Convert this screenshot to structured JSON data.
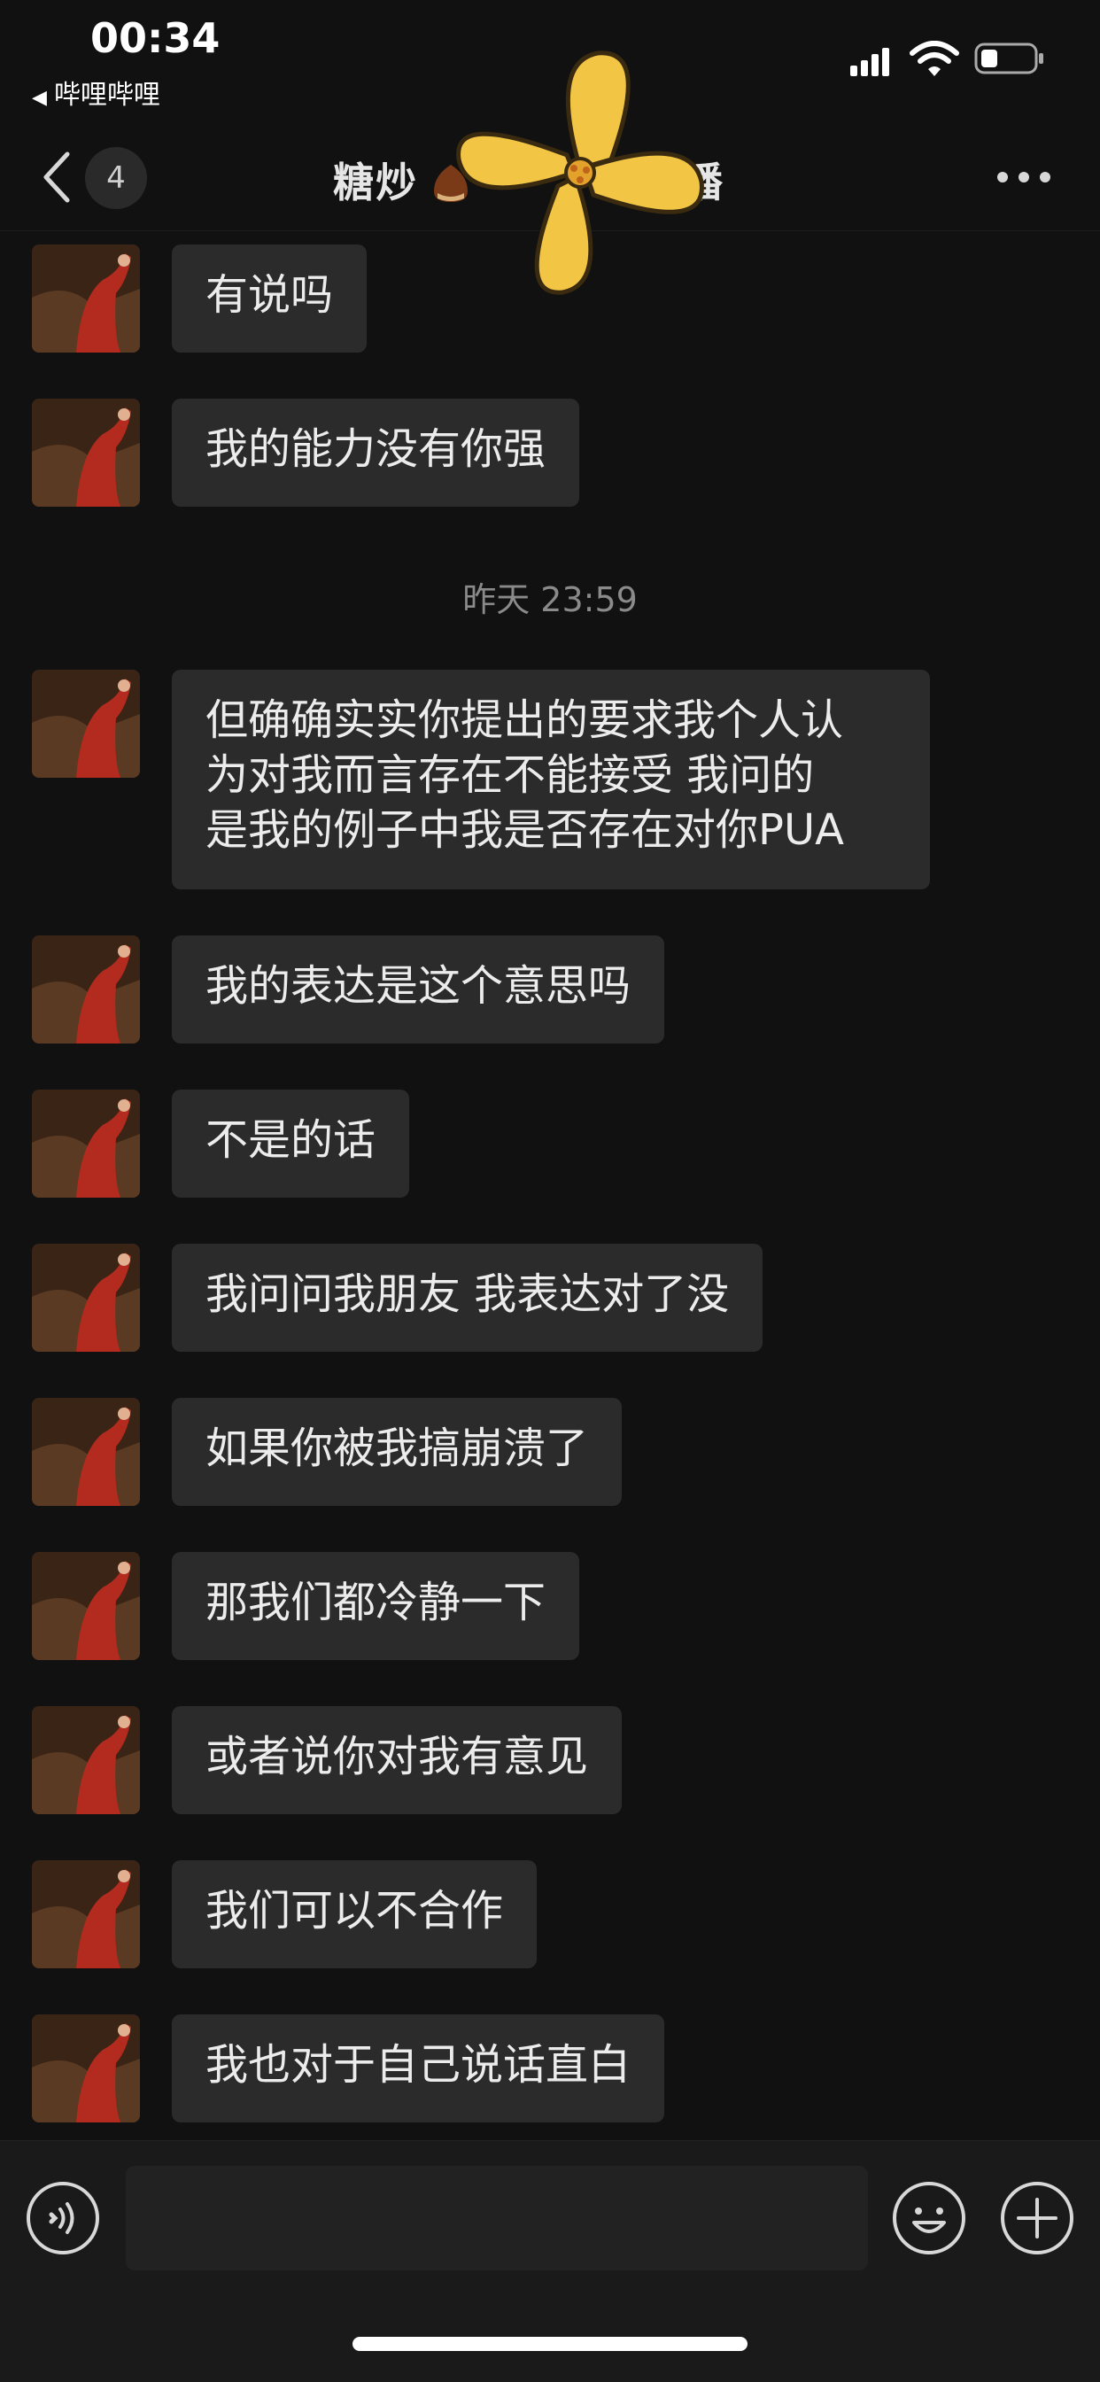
{
  "status": {
    "time": "00:34",
    "back_app": "哔哩哔哩",
    "back_arrow": "◀"
  },
  "nav": {
    "unread_count": "4",
    "title_left": "糖炒",
    "title_right": "主播",
    "back_icon": "chevron-left-icon",
    "more_icon": "more-icon"
  },
  "timestamp": "昨天 23:59",
  "messages": [
    {
      "text": "有说吗"
    },
    {
      "text": "我的能力没有你强"
    },
    {
      "text": "但确确实实你提出的要求我个人认\n为对我而言存在不能接受 我问的\n是我的例子中我是否存在对你PUA"
    },
    {
      "text": "我的表达是这个意思吗"
    },
    {
      "text": "不是的话"
    },
    {
      "text": "我问问我朋友 我表达对了没"
    },
    {
      "text": "如果你被我搞崩溃了"
    },
    {
      "text": "那我们都冷静一下"
    },
    {
      "text": "或者说你对我有意见"
    },
    {
      "text": "我们可以不合作"
    },
    {
      "text": "我也对于自己说话直白"
    }
  ],
  "input": {
    "value": "",
    "placeholder": ""
  },
  "colors": {
    "background": "#111111",
    "bubble": "#2b2b2b",
    "text": "#ececec",
    "timestamp": "#8a8a8a",
    "sticker": "#f3c545"
  }
}
